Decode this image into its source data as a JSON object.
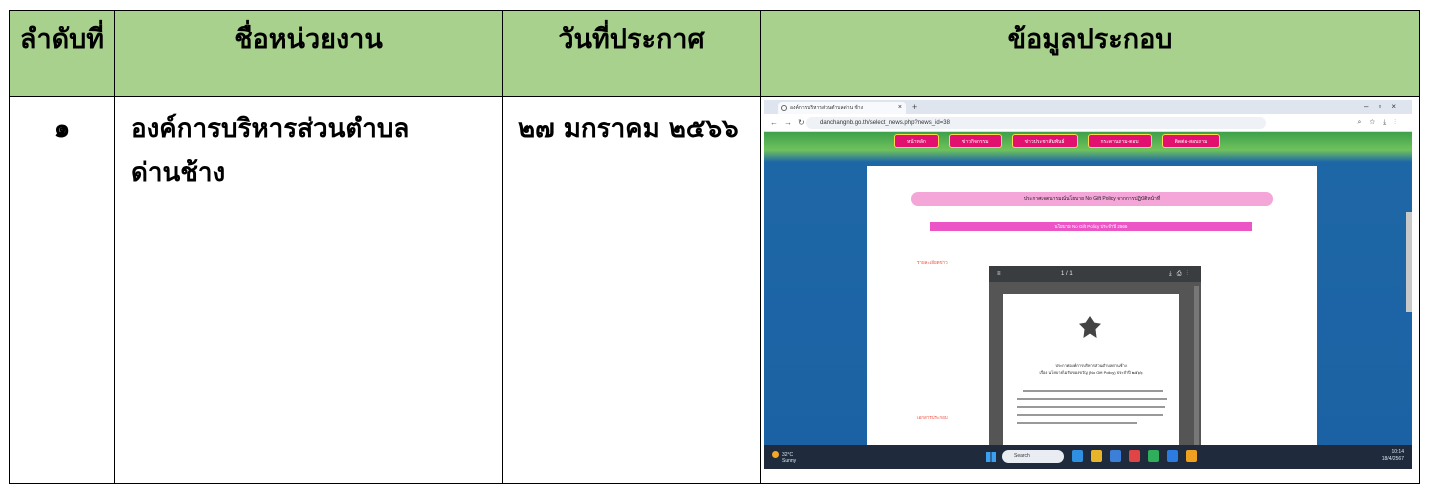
{
  "table": {
    "headers": {
      "number": "ลำดับที่",
      "agency": "ชื่อหน่วยงาน",
      "announce_date": "วันที่ประกาศ",
      "evidence": "ข้อมูลประกอบ"
    },
    "rows": [
      {
        "number": "๑",
        "agency": "องค์การบริหารส่วนตำบลด่านช้าง",
        "announce_date": "๒๗ มกราคม ๒๕๖๖"
      }
    ]
  },
  "screenshot": {
    "tab_title": "องค์การบริหารส่วนตำบลด่าน ช้าง",
    "url": "danchangnb.go.th/select_news.php?news_id=38",
    "menu": [
      "หน้าหลัก",
      "ข่าวกิจกรรม",
      "ข่าวประชาสัมพันธ์",
      "กระดานถาม-ตอบ",
      "ติดต่อ-สอบถาม"
    ],
    "banner_title": "ประกาศเจตนารมณ์นโยบาย No Gift Policy จากการปฏิบัติหน้าที่",
    "policy_bar": "นโยบาย No Gift Policy ประจำปี 2566",
    "detail_label": "รายละเอียดข่าว",
    "attach_label": "เอกสารประกอบ",
    "pdf_page": "1 / 1",
    "doc_heading": "ประกาศองค์การบริหารส่วนตำบลด่านช้าง",
    "doc_subject": "เรื่อง นโยบายไม่รับของขวัญ (No Gift Policy) ประจำปี ๒๕๖๖",
    "weather_temp": "32°C",
    "weather_desc": "Sunny",
    "search_placeholder": "Search",
    "clock_time": "10:14",
    "clock_date": "18/4/2567",
    "colors": {
      "header_bg": "#a9d18e",
      "menu_pink": "#e2116f",
      "site_blue": "#1b62a4"
    }
  }
}
